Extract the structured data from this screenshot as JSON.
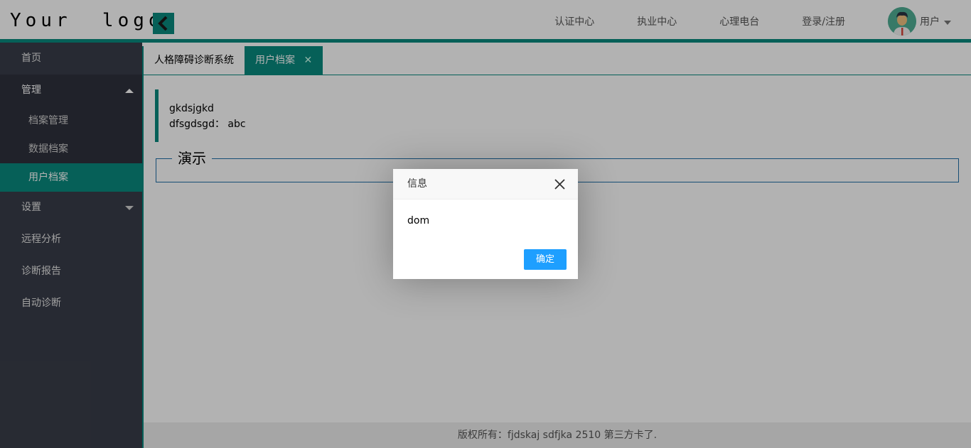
{
  "header": {
    "logo": "Your  logo",
    "nav": [
      "认证中心",
      "执业中心",
      "心理电台",
      "登录/注册"
    ],
    "user_label": "用户"
  },
  "sidebar": {
    "items": [
      {
        "label": "首页"
      },
      {
        "label": "管理",
        "children": [
          "档案管理",
          "数据档案",
          "用户档案"
        ]
      },
      {
        "label": "设置"
      },
      {
        "label": "远程分析"
      },
      {
        "label": "诊断报告"
      },
      {
        "label": "自动诊断"
      }
    ],
    "active_child": "用户档案"
  },
  "tabs": [
    {
      "label": "人格障碍诊断系统"
    },
    {
      "label": "用户档案",
      "close": "✕"
    }
  ],
  "content": {
    "line1": "gkdsjgkd",
    "line2_label": "dfsgdsgd：",
    "line2_value": "abc",
    "fieldset_legend": "演示"
  },
  "footer": {
    "text": "版权所有：fjdskaj sdfjka 2510 第三方卡了."
  },
  "dialog": {
    "title": "信息",
    "message": "dom",
    "confirm_label": "确定"
  },
  "colors": {
    "accent": "#0a8a7e",
    "sidebar_bg": "#393d49",
    "dialog_button": "#1e9fff"
  }
}
